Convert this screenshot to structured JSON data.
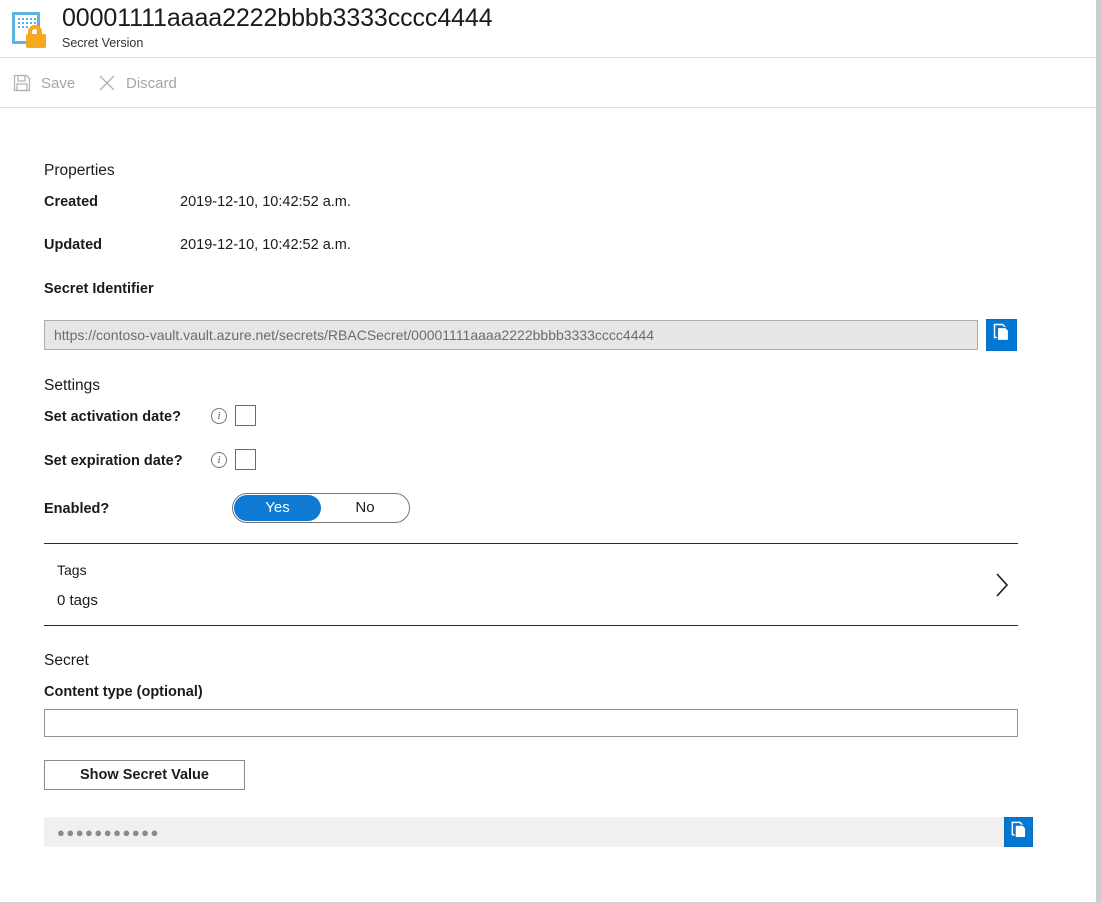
{
  "header": {
    "title": "00001111aaaa2222bbbb3333cccc4444",
    "subtitle": "Secret Version",
    "icon": "secret-certificate-lock-icon"
  },
  "commandbar": {
    "items": [
      {
        "label": "Save",
        "icon": "save-floppy-icon",
        "enabled": false
      },
      {
        "label": "Discard",
        "icon": "close-x-icon",
        "enabled": false
      }
    ]
  },
  "properties": {
    "heading": "Properties",
    "created_label": "Created",
    "created_value": "2019-12-10, 10:42:52 a.m.",
    "updated_label": "Updated",
    "updated_value": "2019-12-10, 10:42:52 a.m.",
    "secret_identifier_label": "Secret Identifier",
    "secret_identifier_value": "https://contoso-vault.vault.azure.net/secrets/RBACSecret/00001111aaaa2222bbbb3333cccc4444",
    "copy_icon": "copy-icon"
  },
  "settings": {
    "heading": "Settings",
    "activation_label": "Set activation date?",
    "activation_info_icon": "info-icon",
    "activation_checked": false,
    "expiration_label": "Set expiration date?",
    "expiration_info_icon": "info-icon",
    "expiration_checked": false,
    "enabled_label": "Enabled?",
    "enabled_yes": "Yes",
    "enabled_no": "No",
    "enabled_selected": "Yes"
  },
  "tags": {
    "title": "Tags",
    "count_label": "0 tags",
    "chevron_icon": "chevron-right-icon"
  },
  "secret": {
    "heading": "Secret",
    "content_type_label": "Content type (optional)",
    "content_type_value": "",
    "content_type_placeholder": "",
    "show_button_label": "Show Secret Value",
    "masked_value": "●●●●●●●●●●●",
    "copy_icon": "copy-icon"
  },
  "colors": {
    "accent_blue": "#0078d4",
    "toggle_blue": "#0f7ad4",
    "icon_amber": "#f6a81e",
    "icon_blue": "#5cb3e0",
    "disabled_gray": "#a6a6a6",
    "field_gray": "#e6e6e6",
    "secret_field_gray": "#f1f0ef"
  }
}
